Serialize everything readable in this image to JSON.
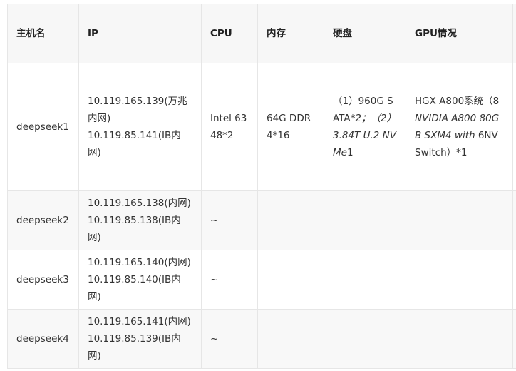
{
  "table": {
    "headers": {
      "hostname": "主机名",
      "ip": "IP",
      "cpu": "CPU",
      "memory": "内存",
      "disk": "硬盘",
      "gpu": "GPU情况"
    },
    "rows": [
      {
        "hostname": "deepseek1",
        "ip_line1": "10.119.165.139(万兆内网)",
        "ip_line2": "10.119.85.141(IB内网)",
        "cpu": "Intel 6348*2",
        "memory": "64G DDR4*16",
        "disk_p1": "（1）960G SATA",
        "disk_p2": "*2；（2）3.84T U.2 NVMe",
        "disk_p3": "1",
        "gpu_p1": "HGX A800系统（8",
        "gpu_p2": "NVIDIA A800 80GB SXM4 with",
        "gpu_p3": " 6NVSwitch）*1"
      },
      {
        "hostname": "deepseek2",
        "ip_line1": "10.119.165.138(内网)",
        "ip_line2": "10.119.85.138(IB内网)",
        "cpu": "~"
      },
      {
        "hostname": "deepseek3",
        "ip_line1": "10.119.165.140(内网)",
        "ip_line2": "10.119.85.140(IB内网)",
        "cpu": "~"
      },
      {
        "hostname": "deepseek4",
        "ip_line1": "10.119.165.141(内网)",
        "ip_line2": "10.119.85.139(IB内网)",
        "cpu": "~"
      }
    ]
  }
}
